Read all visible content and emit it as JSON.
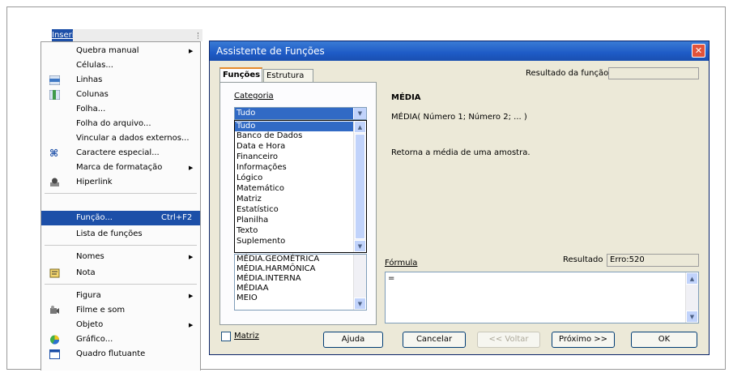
{
  "menubar": {
    "inserir": "Inserir"
  },
  "menu": {
    "items": [
      {
        "label": "Quebra manual",
        "submenu": true
      },
      {
        "label": "Células..."
      },
      {
        "label": "Linhas",
        "icon": "rows-icon"
      },
      {
        "label": "Colunas",
        "icon": "columns-icon"
      },
      {
        "label": "Folha..."
      },
      {
        "label": "Folha do arquivo..."
      },
      {
        "label": "Vincular a dados externos..."
      },
      {
        "label": "Caractere especial...",
        "icon": "special-char-icon"
      },
      {
        "label": "Marca de formatação",
        "submenu": true
      },
      {
        "label": "Hiperlink",
        "icon": "hyperlink-icon"
      },
      {
        "label": "Função...",
        "shortcut": "Ctrl+F2",
        "highlighted": true
      },
      {
        "label": "Lista de funções"
      },
      {
        "label": "Nomes",
        "submenu": true
      },
      {
        "label": "Nota",
        "icon": "note-icon"
      },
      {
        "label": "Figura",
        "submenu": true
      },
      {
        "label": "Filme e som",
        "icon": "movie-sound-icon"
      },
      {
        "label": "Objeto",
        "submenu": true
      },
      {
        "label": "Gráfico...",
        "icon": "chart-icon"
      },
      {
        "label": "Quadro flutuante",
        "icon": "floating-frame-icon"
      }
    ]
  },
  "dialog": {
    "title": "Assistente de Funções",
    "tabs": [
      "Funções",
      "Estrutura"
    ],
    "category_label": "Categoria",
    "category_value": "Tudo",
    "category_options": [
      "Tudo",
      "Banco de Dados",
      "Data e Hora",
      "Financeiro",
      "Informações",
      "Lógico",
      "Matemático",
      "Matriz",
      "Estatístico",
      "Planilha",
      "Texto",
      "Suplemento"
    ],
    "function_list_visible": [
      "MÉDIA.GEOMÉTRICA",
      "MÉDIA.HARMÔNICA",
      "MÉDIA.INTERNA",
      "MÉDIAA",
      "MEIO"
    ],
    "result_label": "Resultado da função",
    "result_value": "",
    "func_name": "MÉDIA",
    "func_syntax": "MÉDIA( Número 1; Número 2; ... )",
    "func_desc": "Retorna a média de uma amostra.",
    "formula_label": "Fórmula",
    "resultado_label": "Resultado",
    "resultado_value": "Erro:520",
    "formula_value": "=",
    "matrix_label": "Matriz",
    "buttons": {
      "help": "Ajuda",
      "cancel": "Cancelar",
      "back": "<< Voltar",
      "next": "Próximo >>",
      "ok": "OK"
    }
  }
}
